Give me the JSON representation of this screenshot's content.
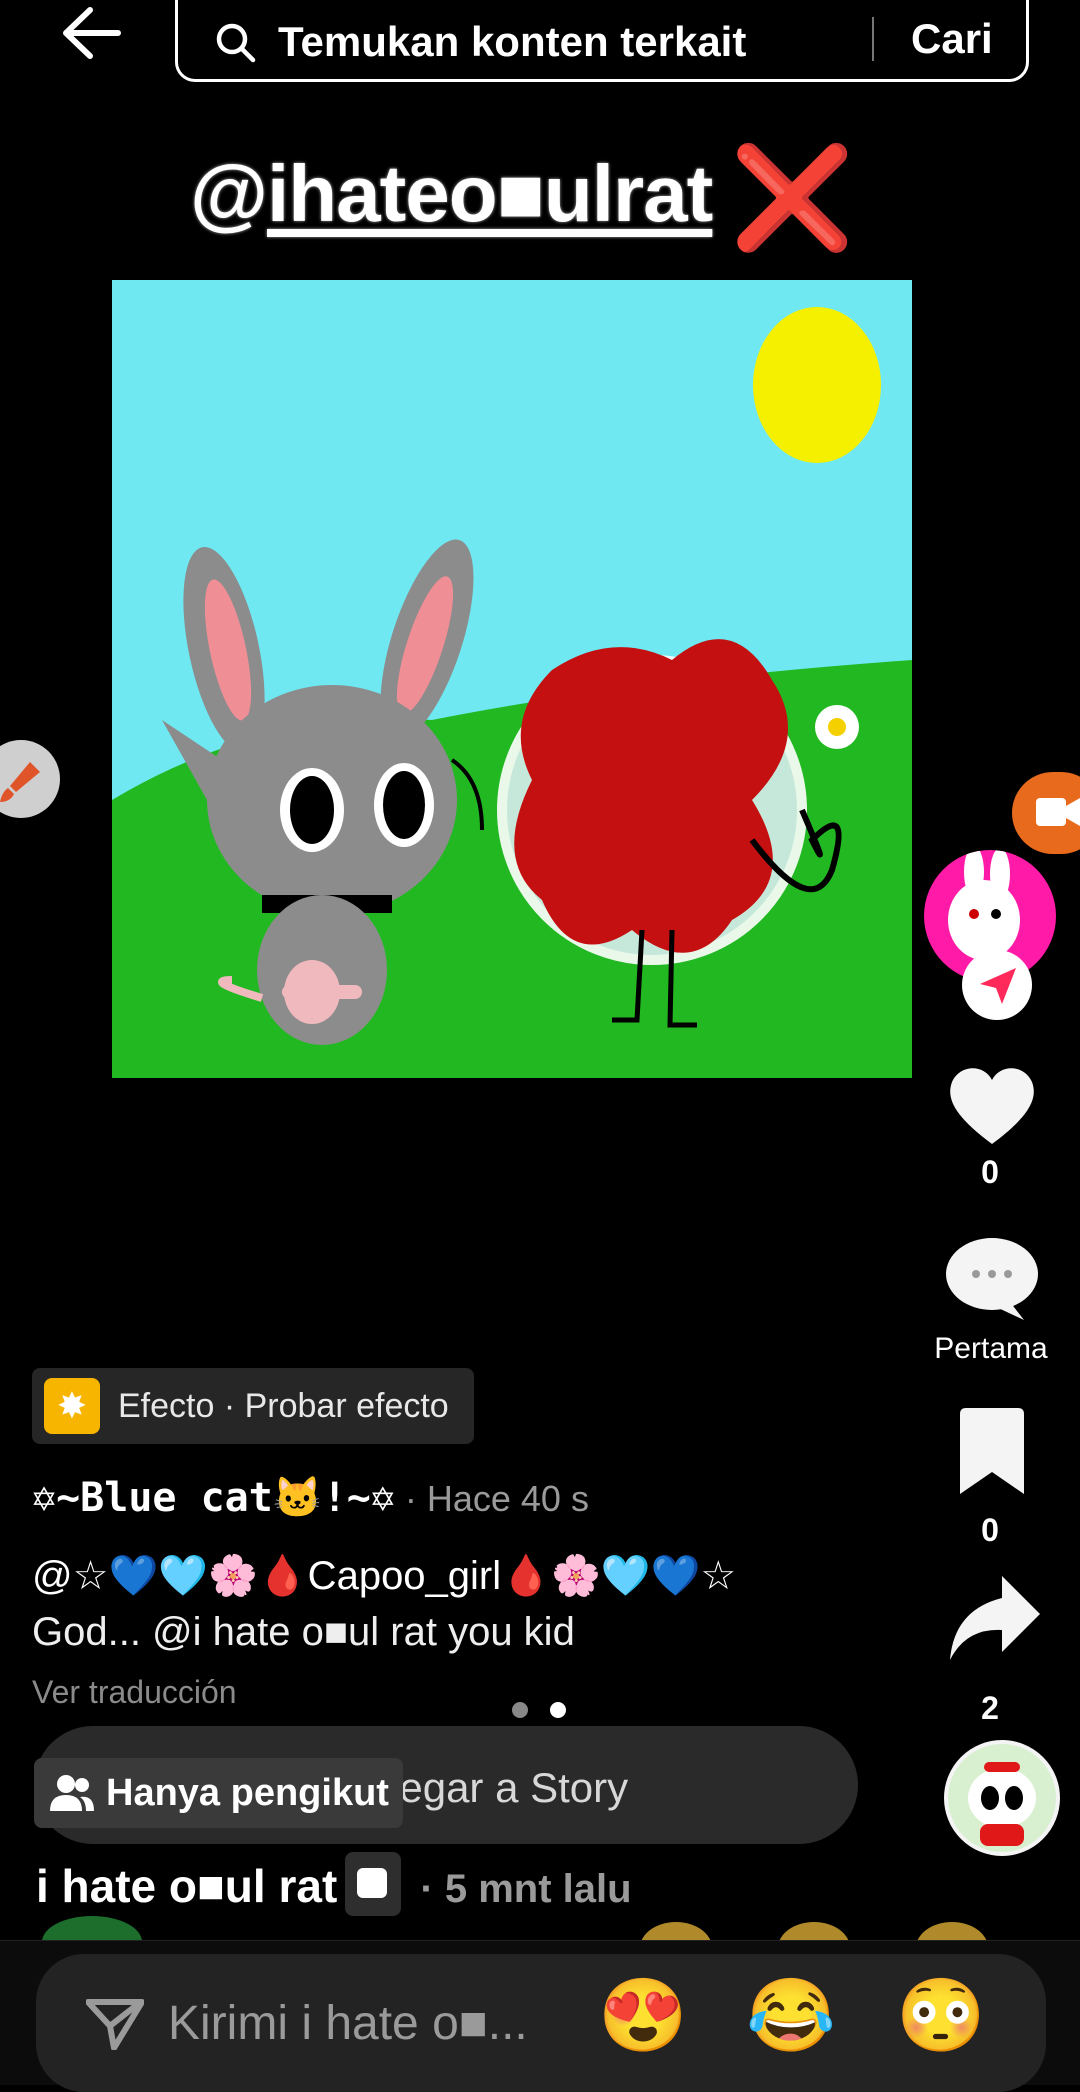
{
  "search": {
    "placeholder": "Temukan konten terkait",
    "button_label": "Cari"
  },
  "video": {
    "handle_prefix": "@",
    "handle_underlined": "ihateo■ulrat",
    "handle_mark": "❌"
  },
  "side_rail": {
    "like_count": "0",
    "comment_label": "Pertama",
    "save_count": "0",
    "share_count": "2"
  },
  "effect": {
    "icon": "✸",
    "label": "Efecto · Probar efecto"
  },
  "post": {
    "author": "✡~Blue cat🐱!~✡",
    "time": " · Hace 40 s",
    "line1": "@☆💙🩵🌸🩸Capoo_girl🩸🌸🩵💙☆",
    "line2": "God... @i hate o■ul rat you kid",
    "translate": "Ver traducción"
  },
  "pager": {
    "active_index": 1,
    "count": 2
  },
  "story": {
    "label": "Agregar a Story",
    "followers_only": "Hanya pengikut"
  },
  "video_meta": {
    "title": "i hate o■ul rat",
    "time": " · 5 mnt lalu"
  },
  "reply_bar": {
    "placeholder": "Kirimi i hate o■...",
    "emoji_1": "😍",
    "emoji_2": "😂",
    "emoji_3": "😳"
  },
  "colors": {
    "background": "#000000",
    "sky": "#6fe8f2",
    "grass": "#22b822",
    "sun": "#f5f000",
    "blob": "#c41010",
    "avatar_pink": "#ff1aa8",
    "camera_orange": "#e86a1c",
    "effect_yellow": "#f7b500"
  },
  "icons": [
    "back-arrow-icon",
    "search-icon",
    "brush-icon",
    "camera-icon",
    "heart-icon",
    "comment-icon",
    "bookmark-icon",
    "share-icon",
    "send-icon",
    "people-icon",
    "star-icon"
  ]
}
